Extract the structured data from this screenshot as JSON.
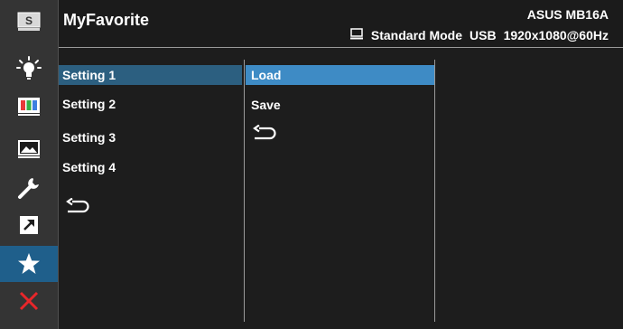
{
  "header": {
    "title": "MyFavorite",
    "model": "ASUS MB16A",
    "status": {
      "mode": "Standard Mode",
      "input": "USB",
      "resolution": "1920x1080@60Hz"
    }
  },
  "sidebar": {
    "items": [
      {
        "icon": "splendid-icon"
      },
      {
        "icon": "blue-light-filter-icon"
      },
      {
        "icon": "color-icon"
      },
      {
        "icon": "image-icon"
      },
      {
        "icon": "system-setup-icon"
      },
      {
        "icon": "shortcut-icon"
      },
      {
        "icon": "myfavorite-star-icon",
        "active": true
      },
      {
        "icon": "exit-icon"
      }
    ]
  },
  "menu": {
    "settings": [
      {
        "label": "Setting 1",
        "selected": true
      },
      {
        "label": "Setting 2"
      },
      {
        "label": "Setting 3"
      },
      {
        "label": "Setting 4"
      }
    ],
    "actions": [
      {
        "label": "Load",
        "selected": true
      },
      {
        "label": "Save"
      }
    ]
  },
  "colors": {
    "background": "#1d1d1d",
    "sidebar": "#343434",
    "active_sidebar": "#1f5f8b",
    "selected_setting": "#2c5f80",
    "selected_action": "#3e8bc5",
    "exit_red": "#e8262a"
  }
}
